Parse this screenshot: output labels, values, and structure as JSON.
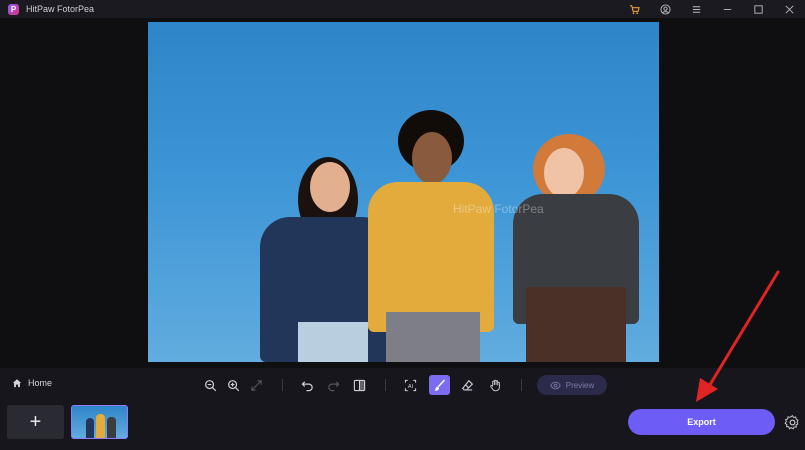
{
  "window": {
    "title": "HitPaw FotorPea"
  },
  "canvas": {
    "watermark": "HitPaw FotorPea"
  },
  "toolbar": {
    "home_label": "Home",
    "preview_label": "Preview",
    "tools": [
      "zoom-out",
      "zoom-in",
      "fit-screen",
      "undo",
      "redo",
      "compare",
      "ai-select",
      "brush",
      "eraser",
      "hand"
    ],
    "active_tool": "brush"
  },
  "bottom": {
    "add_label": "+",
    "export_label": "Export"
  },
  "colors": {
    "accent": "#6d5cf6",
    "annotation_arrow": "#e02424"
  }
}
